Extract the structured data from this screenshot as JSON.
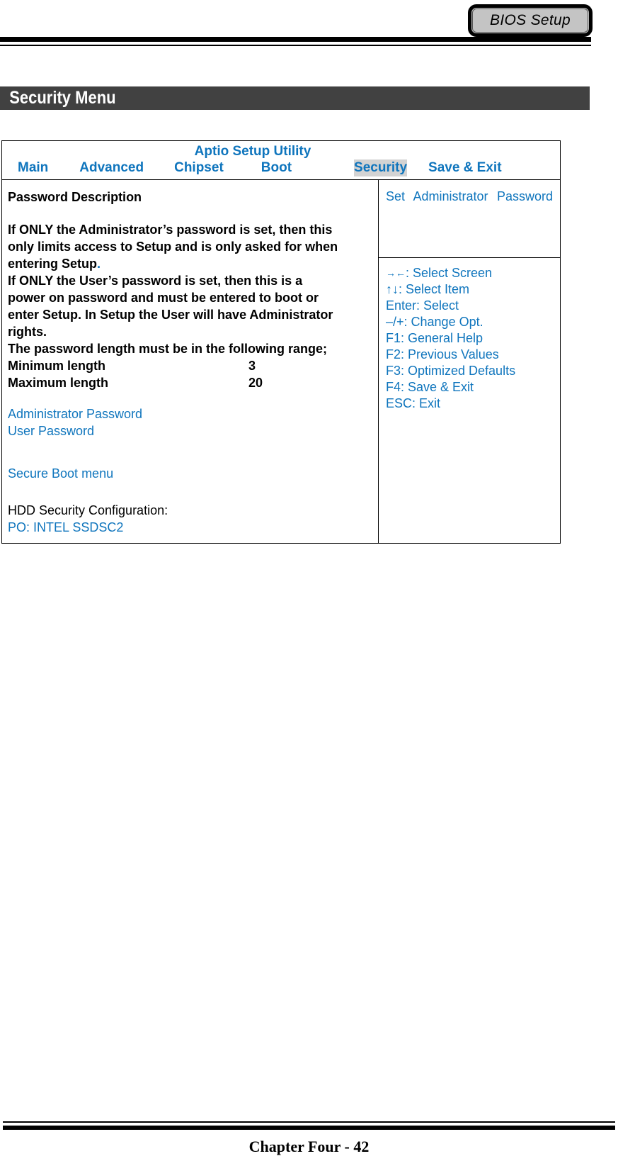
{
  "header": {
    "tab_label": "BIOS Setup"
  },
  "section": {
    "title": "Security Menu"
  },
  "bios": {
    "utility_title": "Aptio Setup Utility",
    "tabs": [
      {
        "label": "Main",
        "selected": false
      },
      {
        "label": "Advanced",
        "selected": false
      },
      {
        "label": "Chipset",
        "selected": false
      },
      {
        "label": "Boot",
        "selected": false
      },
      {
        "label": "Security",
        "selected": true
      },
      {
        "label": "Save & Exit",
        "selected": false
      }
    ],
    "left": {
      "heading": "Password Description",
      "paragraph_lines": [
        "If ONLY the Administrator’s password is set, then this",
        "only limits access to Setup and is only asked for when",
        "entering Setup",
        "If ONLY the User’s password is set, then this is a",
        "power on password and must be entered to boot or",
        "enter Setup. In Setup the User will have Administrator",
        "rights.",
        "The password length must be in the following range;"
      ],
      "trailing_dot": ".",
      "length_rows": [
        {
          "label": "Minimum length",
          "value": "3"
        },
        {
          "label": "Maximum length",
          "value": "20"
        }
      ],
      "password_items": [
        "Administrator Password",
        "User Password"
      ],
      "secure_boot_item": "Secure Boot menu",
      "hdd_heading": "HDD Security Configuration:",
      "hdd_device": "PO: INTEL SSDSC2"
    },
    "right": {
      "help_text": "Set Administrator Password",
      "keys": [
        {
          "glyph": "→←",
          "text": ": Select Screen"
        },
        {
          "glyph": "↑↓",
          "text": ": Select Item"
        },
        {
          "glyph": "",
          "text": "Enter: Select"
        },
        {
          "glyph": "",
          "text": "–/+: Change Opt."
        },
        {
          "glyph": "",
          "text": "F1: General Help"
        },
        {
          "glyph": "",
          "text": "F2: Previous Values"
        },
        {
          "glyph": "",
          "text": "F3: Optimized Defaults"
        },
        {
          "glyph": "",
          "text": "F4: Save & Exit"
        },
        {
          "glyph": "",
          "text": "ESC: Exit"
        }
      ]
    }
  },
  "footer": {
    "page_label": "Chapter Four - 42"
  },
  "colors": {
    "accent_blue": "#0f75bd",
    "section_bar": "#414141",
    "tab_highlight": "#d3d3d3",
    "tab_fill": "#c4c4c4"
  }
}
